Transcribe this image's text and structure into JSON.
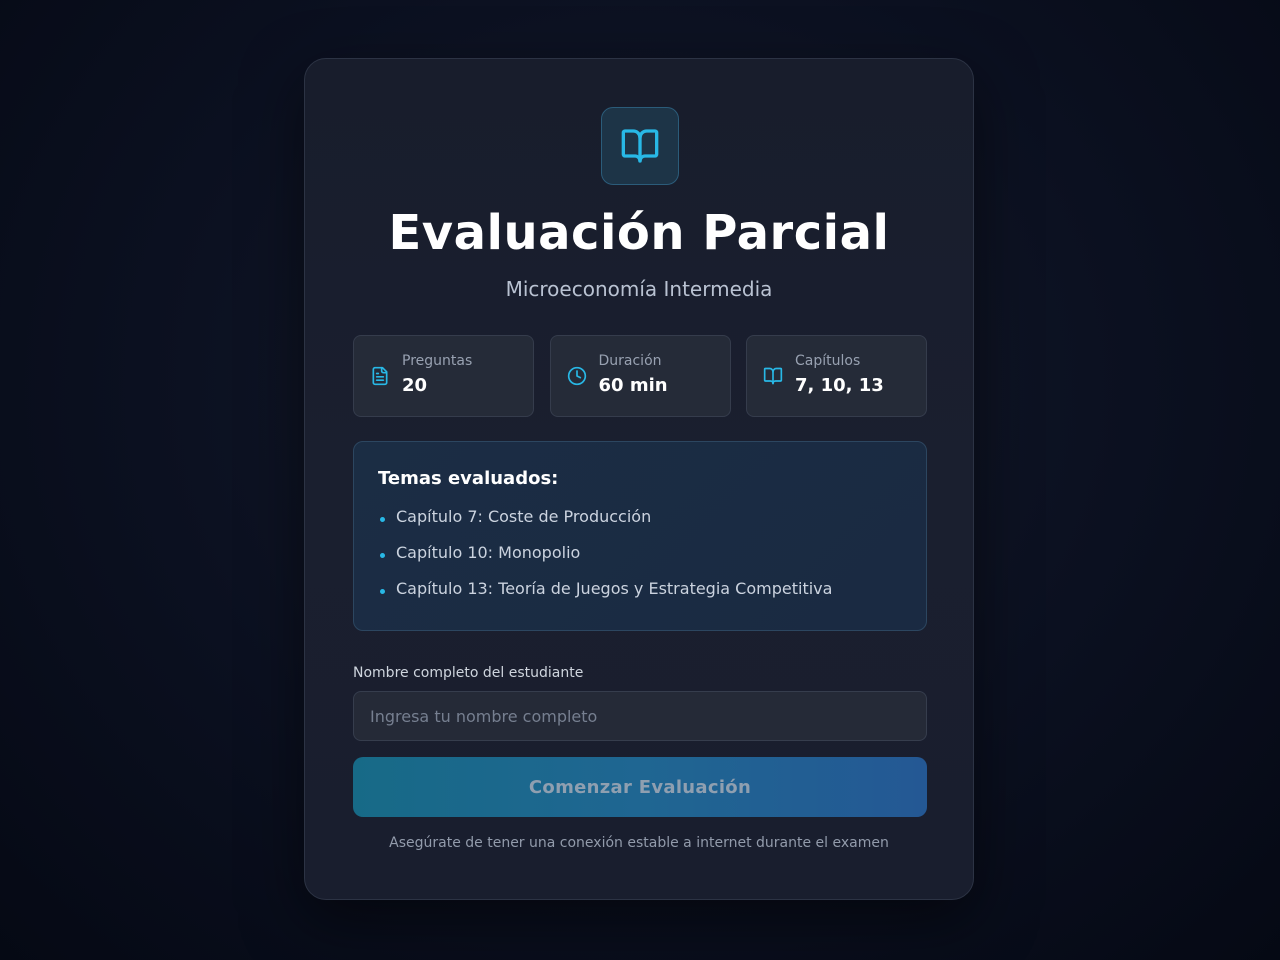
{
  "header": {
    "title": "Evaluación Parcial",
    "subtitle": "Microeconomía Intermedia",
    "logo_icon": "book-open-icon"
  },
  "stats": [
    {
      "icon": "file-text-icon",
      "label": "Preguntas",
      "value": "20"
    },
    {
      "icon": "clock-icon",
      "label": "Duración",
      "value": "60 min"
    },
    {
      "icon": "book-open-icon",
      "label": "Capítulos",
      "value": "7, 10, 13"
    }
  ],
  "topics": {
    "title": "Temas evaluados:",
    "items": [
      "Capítulo 7: Coste de Producción",
      "Capítulo 10: Monopolio",
      "Capítulo 13: Teoría de Juegos y Estrategia Competitiva"
    ]
  },
  "form": {
    "name_label": "Nombre completo del estudiante",
    "name_placeholder": "Ingresa tu nombre completo",
    "name_value": "",
    "start_button": "Comenzar Evaluación",
    "note": "Asegúrate de tener una conexión estable a internet durante el examen"
  },
  "colors": {
    "accent": "#28b8e6",
    "card_bg": "#1a1f2f",
    "button_start": "#176a87",
    "button_end": "#245894"
  }
}
